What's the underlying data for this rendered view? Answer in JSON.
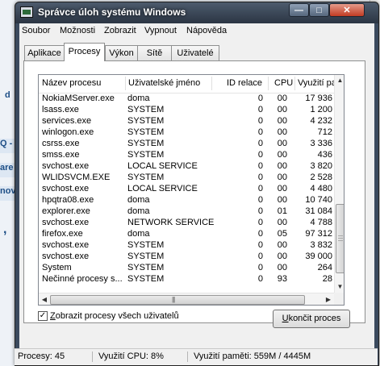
{
  "window": {
    "title": "Správce úloh systému Windows",
    "min_symbol": "—",
    "max_symbol": "□",
    "close_symbol": "✕"
  },
  "menu": [
    "Soubor",
    "Možnosti",
    "Zobrazit",
    "Vypnout",
    "Nápověda"
  ],
  "tabs": [
    {
      "label": "Aplikace",
      "active": false
    },
    {
      "label": "Procesy",
      "active": true
    },
    {
      "label": "Výkon",
      "active": false
    },
    {
      "label": "Sítě",
      "active": false
    },
    {
      "label": "Uživatelé",
      "active": false
    }
  ],
  "table": {
    "columns": [
      "Název procesu",
      "Uživatelské jméno",
      "ID relace",
      "CPU",
      "Využití pa"
    ],
    "rows": [
      [
        "NokiaMServer.exe",
        "doma",
        "0",
        "00",
        "17 936"
      ],
      [
        "lsass.exe",
        "SYSTEM",
        "0",
        "00",
        "1 200"
      ],
      [
        "services.exe",
        "SYSTEM",
        "0",
        "00",
        "4 232"
      ],
      [
        "winlogon.exe",
        "SYSTEM",
        "0",
        "00",
        "712"
      ],
      [
        "csrss.exe",
        "SYSTEM",
        "0",
        "00",
        "3 336"
      ],
      [
        "smss.exe",
        "SYSTEM",
        "0",
        "00",
        "436"
      ],
      [
        "svchost.exe",
        "LOCAL SERVICE",
        "0",
        "00",
        "3 820"
      ],
      [
        "WLIDSVCM.EXE",
        "SYSTEM",
        "0",
        "00",
        "2 528"
      ],
      [
        "svchost.exe",
        "LOCAL SERVICE",
        "0",
        "00",
        "4 480"
      ],
      [
        "hpqtra08.exe",
        "doma",
        "0",
        "00",
        "10 740"
      ],
      [
        "explorer.exe",
        "doma",
        "0",
        "01",
        "31 084"
      ],
      [
        "svchost.exe",
        "NETWORK SERVICE",
        "0",
        "00",
        "4 788"
      ],
      [
        "firefox.exe",
        "doma",
        "0",
        "05",
        "97 312"
      ],
      [
        "svchost.exe",
        "SYSTEM",
        "0",
        "00",
        "3 832"
      ],
      [
        "svchost.exe",
        "SYSTEM",
        "0",
        "00",
        "39 000"
      ],
      [
        "System",
        "SYSTEM",
        "0",
        "00",
        "264"
      ],
      [
        "Nečinné procesy s...",
        "SYSTEM",
        "0",
        "93",
        "28"
      ]
    ],
    "sort_arrow": "▲"
  },
  "show_all_users": {
    "label": "Zobrazit procesy všech uživatelů",
    "checked": true,
    "check_symbol": "✓"
  },
  "end_process_button": "Ukončit proces",
  "statusbar": {
    "processes": "Procesy: 45",
    "cpu": "Využití CPU: 8%",
    "memory": "Využití paměti: 559M / 4445M"
  },
  "background": {
    "fragments": [
      "d",
      "Q -",
      "are",
      "nov",
      ","
    ]
  }
}
